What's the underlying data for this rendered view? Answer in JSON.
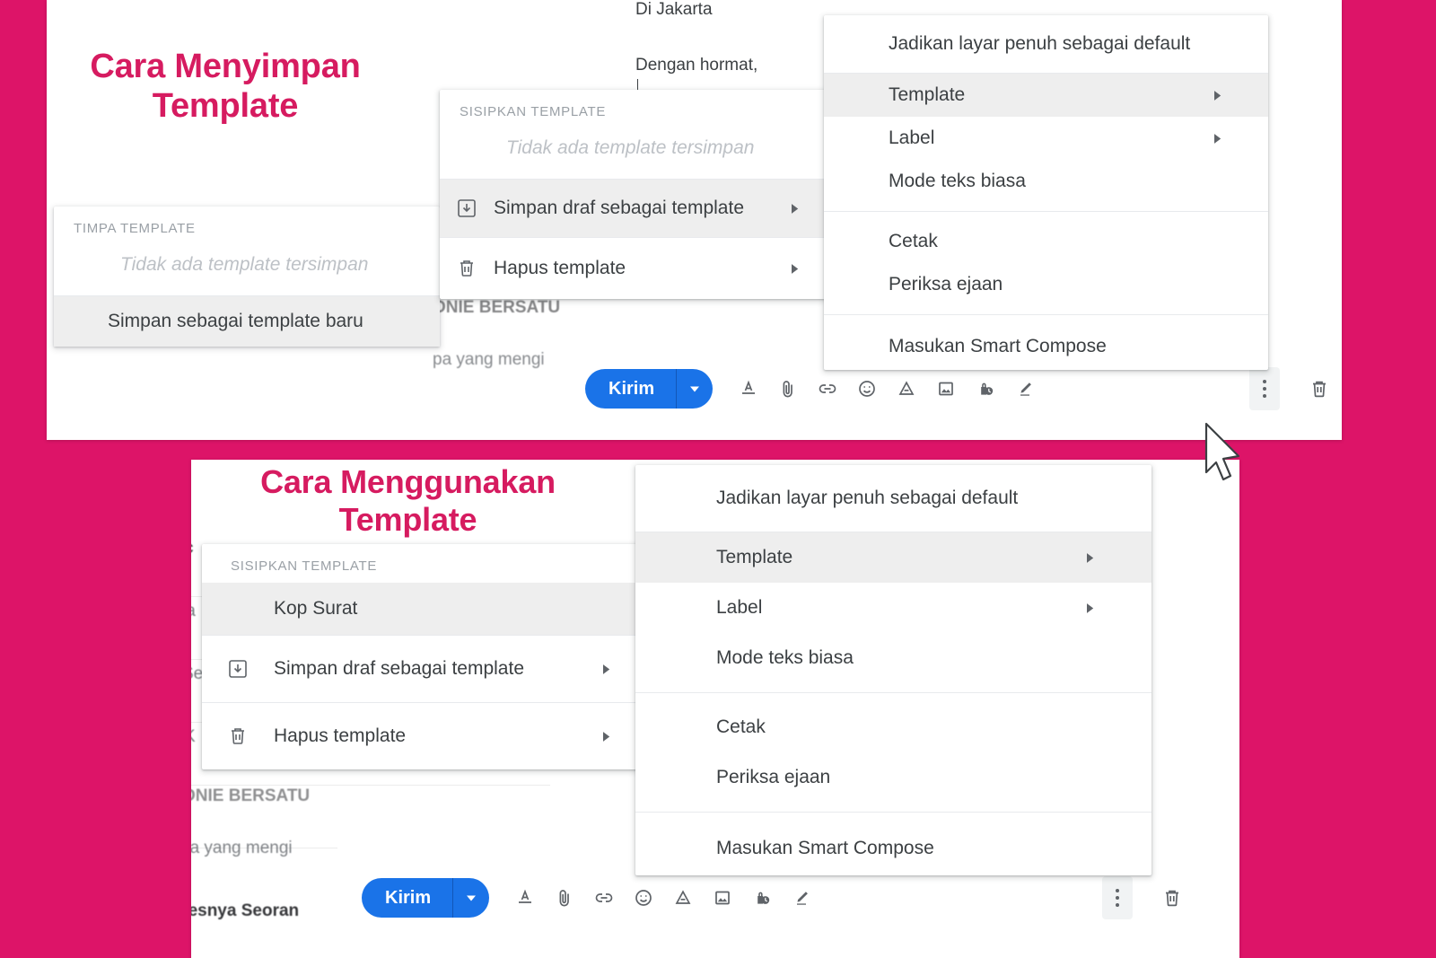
{
  "colors": {
    "background_pink": "#dd1468",
    "headline_pink": "#d61b60",
    "send_button_blue": "#1a73e8",
    "menu_highlight": "#eeeeee",
    "menu_text": "#3c4043"
  },
  "top_section": {
    "headline": "Cara Menyimpan Template",
    "email_body": {
      "line_city": "Di Jakarta",
      "line_greeting": "Dengan hormat,"
    },
    "ghost_text": {
      "line_1": "ONIE BERSATU",
      "line_2": "pa yang mengi"
    },
    "overwrite_menu": {
      "section_label": "TIMPA TEMPLATE",
      "empty_text": "Tidak ada template tersimpan",
      "items": [
        {
          "label": "Simpan sebagai template baru",
          "highlighted": true
        }
      ]
    },
    "template_menu": {
      "section_label": "SISIPKAN TEMPLATE",
      "empty_text": "Tidak ada template tersimpan",
      "items": [
        {
          "label": "Simpan draf sebagai template",
          "icon": "save-template-icon",
          "submenu": true,
          "highlighted": true
        },
        {
          "label": "Hapus template",
          "icon": "trash-icon",
          "submenu": true,
          "highlighted": false
        }
      ]
    },
    "more_menu": {
      "items": [
        {
          "label": "Jadikan layar penuh sebagai default",
          "submenu": false,
          "highlighted": false
        },
        {
          "label": "Template",
          "submenu": true,
          "highlighted": true
        },
        {
          "label": "Label",
          "submenu": true,
          "highlighted": false
        },
        {
          "label": "Mode teks biasa",
          "submenu": false,
          "highlighted": false
        },
        {
          "label": "Cetak",
          "submenu": false,
          "highlighted": false
        },
        {
          "label": "Periksa ejaan",
          "submenu": false,
          "highlighted": false
        },
        {
          "label": "Masukan Smart Compose",
          "submenu": false,
          "highlighted": false
        }
      ]
    },
    "toolbar": {
      "send_label": "Kirim",
      "icons": [
        "format-options-icon",
        "attach-file-icon",
        "insert-link-icon",
        "insert-emoji-icon",
        "insert-drive-icon",
        "insert-photo-icon",
        "confidential-mode-icon",
        "insert-signature-icon"
      ],
      "more_options": "more-options-icon",
      "discard": "discard-draft-icon"
    }
  },
  "bottom_section": {
    "headline": "Cara Menggunakan Template",
    "ghost_text": {
      "line_1": "c",
      "line_2": "la",
      "line_3": "Se",
      "line_4": "K",
      "line_5": "ONIE BERSATU",
      "line_6": "pa yang mengi",
      "line_7": "sesnya Seoran"
    },
    "template_menu": {
      "section_label": "SISIPKAN TEMPLATE",
      "items": [
        {
          "label": "Kop Surat",
          "icon": "",
          "submenu": false,
          "highlighted": true
        },
        {
          "label": "Simpan draf sebagai template",
          "icon": "save-template-icon",
          "submenu": true,
          "highlighted": false
        },
        {
          "label": "Hapus template",
          "icon": "trash-icon",
          "submenu": true,
          "highlighted": false
        }
      ]
    },
    "more_menu": {
      "items": [
        {
          "label": "Jadikan layar penuh sebagai default",
          "submenu": false,
          "highlighted": false
        },
        {
          "label": "Template",
          "submenu": true,
          "highlighted": true
        },
        {
          "label": "Label",
          "submenu": true,
          "highlighted": false
        },
        {
          "label": "Mode teks biasa",
          "submenu": false,
          "highlighted": false
        },
        {
          "label": "Cetak",
          "submenu": false,
          "highlighted": false
        },
        {
          "label": "Periksa ejaan",
          "submenu": false,
          "highlighted": false
        },
        {
          "label": "Masukan Smart Compose",
          "submenu": false,
          "highlighted": false
        }
      ]
    },
    "toolbar": {
      "send_label": "Kirim",
      "icons": [
        "format-options-icon",
        "attach-file-icon",
        "insert-link-icon",
        "insert-emoji-icon",
        "insert-drive-icon",
        "insert-photo-icon",
        "confidential-mode-icon",
        "insert-signature-icon"
      ],
      "more_options": "more-options-icon",
      "discard": "discard-draft-icon"
    }
  },
  "cursor": {
    "name": "mouse-pointer"
  }
}
